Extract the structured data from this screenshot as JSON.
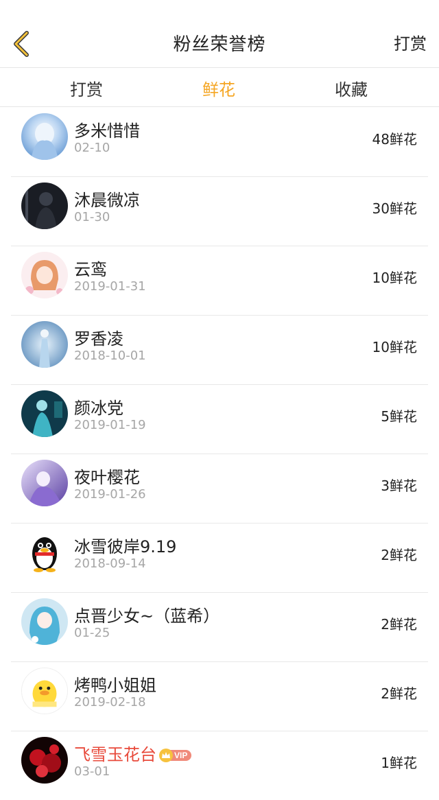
{
  "header": {
    "title": "粉丝荣誉榜",
    "action_label": "打赏"
  },
  "tabs": [
    {
      "label": "打赏",
      "active": false
    },
    {
      "label": "鲜花",
      "active": true
    },
    {
      "label": "收藏",
      "active": false
    }
  ],
  "colors": {
    "accent": "#f5a623",
    "vip_name": "#e84a3b",
    "date": "#a6a6a6"
  },
  "fans": [
    {
      "name": "多米惜惜",
      "date": "02-10",
      "count": "48鲜花",
      "avatar": "anime-girl-blue-avatar"
    },
    {
      "name": "沐晨微凉",
      "date": "01-30",
      "count": "30鲜花",
      "avatar": "dark-figure-avatar"
    },
    {
      "name": "云鸾",
      "date": "2019-01-31",
      "count": "10鲜花",
      "avatar": "anime-girl-orange-hair-avatar"
    },
    {
      "name": "罗香凌",
      "date": "2018-10-01",
      "count": "10鲜花",
      "avatar": "fairy-blue-avatar"
    },
    {
      "name": "颜冰党",
      "date": "2019-01-19",
      "count": "5鲜花",
      "avatar": "teal-character-avatar"
    },
    {
      "name": "夜叶樱花",
      "date": "2019-01-26",
      "count": "3鲜花",
      "avatar": "purple-anime-avatar"
    },
    {
      "name": "冰雪彼岸9.19",
      "date": "2018-09-14",
      "count": "2鲜花",
      "avatar": "qq-penguin-avatar"
    },
    {
      "name": "点晋少女~（蓝希）",
      "date": "01-25",
      "count": "2鲜花",
      "avatar": "blue-hair-anime-avatar"
    },
    {
      "name": "烤鸭小姐姐",
      "date": "2019-02-18",
      "count": "2鲜花",
      "avatar": "yellow-duck-avatar"
    },
    {
      "name": "飞雪玉花台",
      "date": "03-01",
      "count": "1鲜花",
      "avatar": "red-flowers-avatar",
      "vip": true,
      "vip_label": "VIP"
    }
  ]
}
